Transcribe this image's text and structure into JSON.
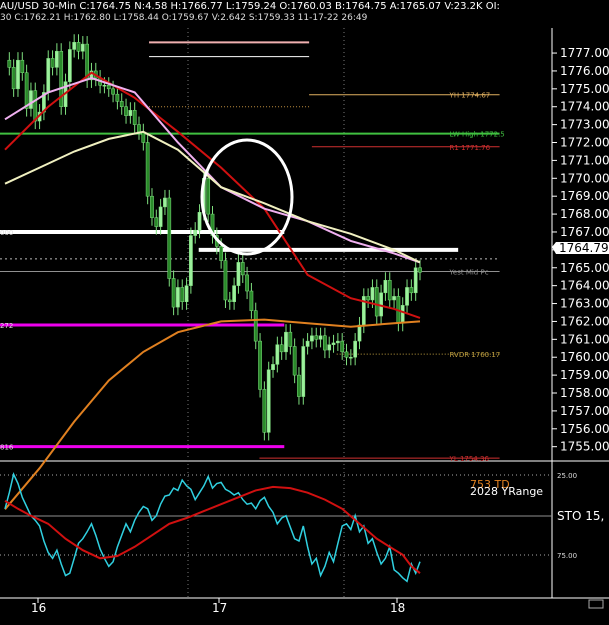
{
  "header": {
    "line1": "AU/USD 30-Min C:1764.75 N:4.58 H:1766.77 L:1759.24 O:1760.03 B:1764.75 A:1765.07 V:23.2K OI:",
    "line2": "30 C:1762.21 H:1762.80 L:1758.44 O:1759.67 V:2.642 S:1759.33 11-17-22 26:49"
  },
  "price_tag": "1764.79",
  "chart_data": [
    {
      "type": "line",
      "panel": "price",
      "ylim": [
        1754.2,
        1778.4
      ],
      "yticks": [
        "1777.00",
        "1776.00",
        "1775.00",
        "1774.00",
        "1773.00",
        "1772.00",
        "1771.00",
        "1770.00",
        "1769.00",
        "1768.00",
        "1767.00",
        "1766.00",
        "1765.00",
        "1764.00",
        "1763.00",
        "1762.00",
        "1761.00",
        "1760.00",
        "1759.00",
        "1758.00",
        "1757.00",
        "1756.00",
        "1755.00"
      ],
      "xticks": [
        {
          "label": "16",
          "pos": 0.03
        },
        {
          "label": "17",
          "pos": 0.17
        },
        {
          "label": "18",
          "pos": 0.31
        }
      ],
      "close": [
        1776.6,
        1776.2,
        1775.0,
        1776.6,
        1775.9,
        1773.9,
        1774.9,
        1773.2,
        1773.7,
        1774.8,
        1776.7,
        1776.2,
        1777.1,
        1774.0,
        1775.4,
        1777.2,
        1777.6,
        1777.1,
        1777.5,
        1775.5,
        1776.0,
        1775.6,
        1775.2,
        1775.2,
        1775.0,
        1774.7,
        1774.3,
        1774.0,
        1773.5,
        1773.8,
        1773.0,
        1772.6,
        1772.0,
        1769.0,
        1767.8,
        1767.3,
        1768.4,
        1768.9,
        1764.4,
        1762.8,
        1763.9,
        1763.1,
        1764.0,
        1766.8,
        1767.1,
        1768.1,
        1770.0,
        1768.0,
        1766.8,
        1766.2,
        1765.4,
        1763.2,
        1763.1,
        1764.0,
        1765.3,
        1764.6,
        1763.7,
        1762.6,
        1760.9,
        1758.2,
        1755.8,
        1759.3,
        1759.6,
        1760.7,
        1760.3,
        1761.4,
        1760.6,
        1759.0,
        1757.8,
        1760.6,
        1760.9,
        1761.2,
        1761.0,
        1761.2,
        1760.4,
        1760.7,
        1760.8,
        1760.9,
        1760.3,
        1760.0,
        1760.0,
        1760.9,
        1761.8,
        1763.4,
        1763.2,
        1763.9,
        1762.3,
        1763.6,
        1764.3,
        1763.2,
        1763.4,
        1761.9,
        1762.9,
        1763.9,
        1763.6,
        1765.0,
        1764.75
      ],
      "overlays": [
        {
          "name": "red-ma",
          "color": "#d01010",
          "values": [
            [
              1771.6,
              0
            ],
            [
              1774.0,
              10
            ],
            [
              1775.9,
              20
            ],
            [
              1774.5,
              30
            ],
            [
              1772.6,
              40
            ],
            [
              1770.6,
              50
            ],
            [
              1768.3,
              60
            ],
            [
              1764.6,
              70
            ],
            [
              1763.3,
              80
            ],
            [
              1762.7,
              90
            ],
            [
              1762.2,
              96
            ]
          ]
        },
        {
          "name": "pink-ma",
          "color": "#f0b0f0",
          "values": [
            [
              1773.3,
              0
            ],
            [
              1774.8,
              10
            ],
            [
              1775.6,
              20
            ],
            [
              1774.8,
              30
            ],
            [
              1772.0,
              40
            ],
            [
              1769.5,
              50
            ],
            [
              1768.3,
              60
            ],
            [
              1767.6,
              70
            ],
            [
              1766.5,
              80
            ],
            [
              1765.8,
              90
            ],
            [
              1765.3,
              96
            ]
          ]
        },
        {
          "name": "yellow-ma",
          "color": "#f0f0c0",
          "values": [
            [
              1769.7,
              0
            ],
            [
              1770.6,
              8
            ],
            [
              1771.5,
              16
            ],
            [
              1772.2,
              24
            ],
            [
              1772.6,
              32
            ],
            [
              1771.6,
              40
            ],
            [
              1769.5,
              50
            ],
            [
              1768.6,
              60
            ],
            [
              1767.6,
              70
            ],
            [
              1766.9,
              80
            ],
            [
              1766.0,
              90
            ],
            [
              1765.3,
              96
            ]
          ]
        },
        {
          "name": "orange-ma",
          "color": "#e08020",
          "values": [
            [
              1751.5,
              0
            ],
            [
              1753.8,
              8
            ],
            [
              1756.4,
              16
            ],
            [
              1758.7,
              24
            ],
            [
              1760.3,
              32
            ],
            [
              1761.4,
              40
            ],
            [
              1762.0,
              50
            ],
            [
              1762.1,
              60
            ],
            [
              1761.9,
              70
            ],
            [
              1761.7,
              80
            ],
            [
              1761.9,
              90
            ],
            [
              1762.0,
              96
            ]
          ]
        }
      ],
      "levels": [
        {
          "price": 1777.6,
          "color": "#f0b0b0",
          "x_from": 0.27,
          "x_to": 0.56,
          "width": 2
        },
        {
          "price": 1776.8,
          "color": "#ffffff",
          "x_from": 0.27,
          "x_to": 0.56,
          "width": 1
        },
        {
          "price": 1774.67,
          "color": "#e0b060",
          "x_from": 0.56,
          "x_to": 0.905,
          "width": 1,
          "label": "YH 1774.67"
        },
        {
          "price": 1774.0,
          "color": "#c09040",
          "x_from": 0.27,
          "x_to": 0.56,
          "width": 1,
          "dash": "1,2"
        },
        {
          "price": 1772.5,
          "color": "#40c040",
          "x_from": 0.0,
          "x_to": 0.905,
          "width": 2,
          "label": "LW High 1772.5"
        },
        {
          "price": 1771.76,
          "color": "#d03030",
          "x_from": 0.565,
          "x_to": 0.905,
          "width": 1,
          "label": "R1 1771.76"
        },
        {
          "price": 1767.0,
          "color": "#ffffff",
          "x_from": 0.0,
          "x_to": 0.515,
          "width": 4,
          "label_left": "000"
        },
        {
          "price": 1766.0,
          "color": "#ffffff",
          "x_from": 0.36,
          "x_to": 0.83,
          "width": 4
        },
        {
          "price": 1764.79,
          "color": "#909090",
          "x_from": 0.0,
          "x_to": 0.905,
          "width": 1,
          "label": "Yest Mid Pc"
        },
        {
          "price": 1765.5,
          "color": "#bbbbbb",
          "x_from": 0.0,
          "x_to": 0.905,
          "width": 1,
          "dash": "2,3"
        },
        {
          "price": 1761.8,
          "color": "#ee00ee",
          "x_from": 0.0,
          "x_to": 0.515,
          "width": 3,
          "label_left": "272"
        },
        {
          "price": 1760.17,
          "color": "#c0a040",
          "x_from": 0.61,
          "x_to": 0.905,
          "width": 1,
          "dash": "1,2",
          "label": "RVDR 1760.17"
        },
        {
          "price": 1755.0,
          "color": "#ee00ee",
          "x_from": 0.0,
          "x_to": 0.515,
          "width": 3,
          "label_left": "816"
        },
        {
          "price": 1754.36,
          "color": "#d03030",
          "x_from": 0.47,
          "x_to": 0.905,
          "width": 1,
          "label": "YL 1754.36"
        }
      ]
    },
    {
      "type": "line",
      "panel": "stochastic",
      "ylim": [
        0,
        100
      ],
      "yticks": [
        "25.00",
        "75.00"
      ],
      "labels": [
        "753 TD",
        "2028 YRange",
        "STO 15,"
      ],
      "k_line": [
        68,
        82,
        98,
        90,
        78,
        70,
        62,
        58,
        53,
        40,
        30,
        25,
        32,
        20,
        10,
        12,
        25,
        38,
        42,
        48,
        55,
        45,
        33,
        25,
        18,
        22,
        35,
        45,
        55,
        48,
        58,
        65,
        70,
        68,
        58,
        62,
        72,
        79,
        80,
        86,
        84,
        93,
        88,
        85,
        76,
        82,
        88,
        96,
        86,
        90,
        91,
        85,
        83,
        80,
        82,
        76,
        72,
        73,
        68,
        75,
        78,
        70,
        65,
        55,
        60,
        62,
        52,
        42,
        40,
        53,
        35,
        20,
        25,
        10,
        18,
        30,
        22,
        38,
        53,
        55,
        50,
        62,
        48,
        53,
        38,
        42,
        30,
        20,
        25,
        35,
        15,
        12,
        8,
        5,
        20,
        12,
        22
      ],
      "d_line": [
        [
          75,
          0
        ],
        [
          68,
          3
        ],
        [
          62,
          6
        ],
        [
          55,
          10
        ],
        [
          42,
          14
        ],
        [
          32,
          18
        ],
        [
          25,
          22
        ],
        [
          27,
          26
        ],
        [
          35,
          30
        ],
        [
          45,
          34
        ],
        [
          55,
          38
        ],
        [
          60,
          42
        ],
        [
          66,
          46
        ],
        [
          72,
          50
        ],
        [
          78,
          54
        ],
        [
          84,
          58
        ],
        [
          87,
          62
        ],
        [
          86,
          66
        ],
        [
          82,
          70
        ],
        [
          76,
          74
        ],
        [
          68,
          78
        ],
        [
          55,
          82
        ],
        [
          42,
          86
        ],
        [
          35,
          89
        ],
        [
          28,
          92
        ],
        [
          18,
          94
        ],
        [
          12,
          96
        ]
      ]
    }
  ]
}
